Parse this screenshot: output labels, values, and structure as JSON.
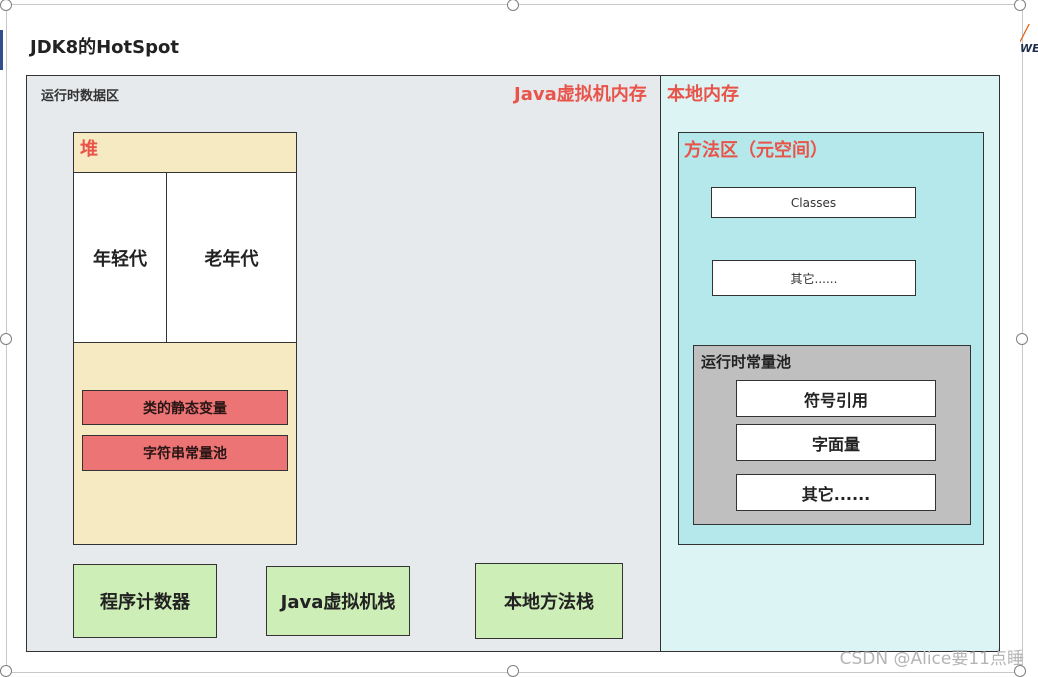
{
  "slide": {
    "title": "JDK8的HotSpot"
  },
  "runtime_data_area": {
    "label": "运行时数据区",
    "jvm_memory_label": "Java虚拟机内存"
  },
  "native_memory": {
    "label": "本地内存"
  },
  "heap": {
    "label": "堆",
    "young_gen": "年轻代",
    "old_gen": "老年代",
    "static_vars": "类的静态变量",
    "string_pool": "字符串常量池"
  },
  "thread_areas": {
    "program_counter": "程序计数器",
    "jvm_stack": "Java虚拟机栈",
    "native_method_stack": "本地方法栈"
  },
  "method_area": {
    "label": "方法区（元空间）",
    "classes": "Classes",
    "others": "其它......"
  },
  "runtime_constant_pool": {
    "label": "运行时常量池",
    "symbol_ref": "符号引用",
    "literal": "字面量",
    "others": "其它......"
  },
  "watermark": "CSDN @Alice要11点睡",
  "colors": {
    "jvm_area_bg": "#e7eaed",
    "native_area_bg": "#dcf4f4",
    "heap_bg": "#f6eac2",
    "red_box": "#ec7474",
    "green_box": "#cdeeb7",
    "method_area_bg": "#b4e8ea",
    "pool_bg": "#bfbfbf",
    "accent_red_text": "#e8534a"
  }
}
